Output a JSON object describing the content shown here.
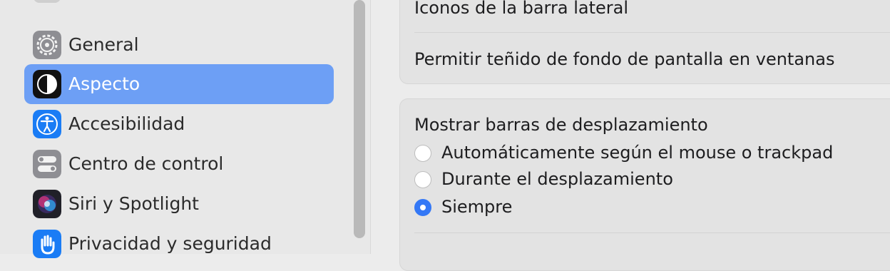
{
  "sidebar": {
    "items": [
      {
        "label": "General",
        "icon": "gear-icon",
        "selected": false
      },
      {
        "label": "Aspecto",
        "icon": "appearance-icon",
        "selected": true
      },
      {
        "label": "Accesibilidad",
        "icon": "accessibility-icon",
        "selected": false
      },
      {
        "label": "Centro de control",
        "icon": "control-center-icon",
        "selected": false
      },
      {
        "label": "Siri y Spotlight",
        "icon": "siri-icon",
        "selected": false
      },
      {
        "label": "Privacidad y seguridad",
        "icon": "hand-icon",
        "selected": false
      }
    ]
  },
  "main": {
    "card1": {
      "sidebar_icons_label": "Iconos de la barra lateral",
      "wallpaper_tint_label": "Permitir teñido de fondo de pantalla en ventanas"
    },
    "scrollbars": {
      "title": "Mostrar barras de desplazamiento",
      "options": [
        {
          "label": "Automáticamente según el mouse o trackpad",
          "checked": false
        },
        {
          "label": "Durante el desplazamiento",
          "checked": false
        },
        {
          "label": "Siempre",
          "checked": true
        }
      ]
    }
  },
  "colors": {
    "accent": "#3478f6",
    "selection": "#6d9ff5"
  }
}
